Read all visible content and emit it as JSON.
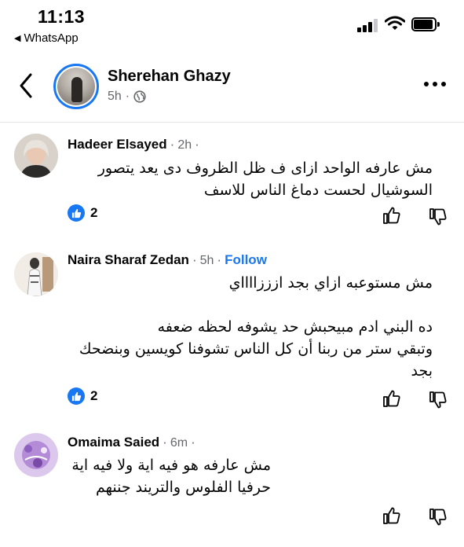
{
  "status_bar": {
    "time": "11:13",
    "back_app": "WhatsApp",
    "icons": [
      "cellular-signal-icon",
      "wifi-icon",
      "battery-icon"
    ]
  },
  "header": {
    "author_name": "Sherehan Ghazy",
    "post_time": "5h",
    "separator": "·",
    "privacy_icon": "globe-icon",
    "more_icon": "more-dots-icon",
    "back_icon": "back-chevron-icon"
  },
  "comments": [
    {
      "name": "Hadeer Elsayed",
      "time": "2h",
      "lines": [
        "مش عارفه الواحد ازاى ف ظل الظروف دى يعد يتصور",
        "السوشيال لحست دماغ الناس للاسف"
      ],
      "reaction_count": "2"
    },
    {
      "name": "Naira Sharaf Zedan",
      "time": "5h",
      "follow_label": "Follow",
      "paragraph1": "مش مستوعبه ازاي بجد ازززااااي",
      "paragraph2": [
        "ده البني ادم مبيحبش حد يشوفه لحظه ضعفه",
        "وتبقي ستر من ربنا أن كل الناس تشوفنا كويسين وبنضحك",
        "بجد"
      ],
      "reaction_count": "2"
    },
    {
      "name": "Omaima Saied",
      "time": "6m",
      "lines": [
        "مش عارفه هو فيه اية ولا فيه اية",
        "حرفيا الفلوس والتريند جننهم"
      ]
    }
  ],
  "colors": {
    "accent": "#1877f2",
    "secondary_text": "#65676b",
    "divider": "#e4e6eb"
  }
}
